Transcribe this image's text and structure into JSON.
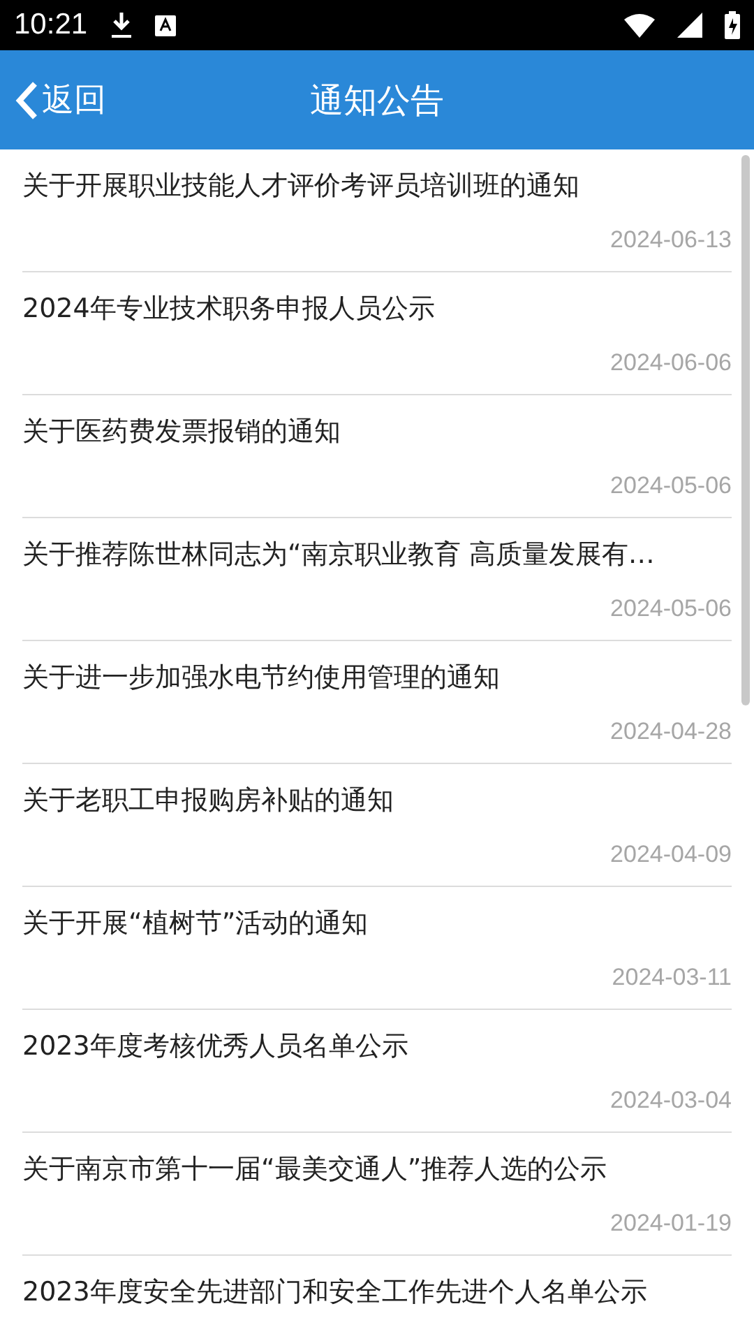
{
  "status_bar": {
    "time": "10:21"
  },
  "header": {
    "back": "返回",
    "title": "通知公告"
  },
  "notices": [
    {
      "title": "关于开展职业技能人才评价考评员培训班的通知",
      "date": "2024-06-13"
    },
    {
      "title": "2024年专业技术职务申报人员公示",
      "date": "2024-06-06"
    },
    {
      "title": "关于医药费发票报销的通知",
      "date": "2024-05-06"
    },
    {
      "title": "关于推荐陈世林同志为“南京职业教育 高质量发展有…",
      "date": "2024-05-06"
    },
    {
      "title": "关于进一步加强水电节约使用管理的通知",
      "date": "2024-04-28"
    },
    {
      "title": "关于老职工申报购房补贴的通知",
      "date": "2024-04-09"
    },
    {
      "title": "关于开展“植树节”活动的通知",
      "date": "2024-03-11"
    },
    {
      "title": "2023年度考核优秀人员名单公示",
      "date": "2024-03-04"
    },
    {
      "title": "关于南京市第十一届“最美交通人”推荐人选的公示",
      "date": "2024-01-19"
    },
    {
      "title": "2023年度安全先进部门和安全工作先进个人名单公示"
    }
  ]
}
